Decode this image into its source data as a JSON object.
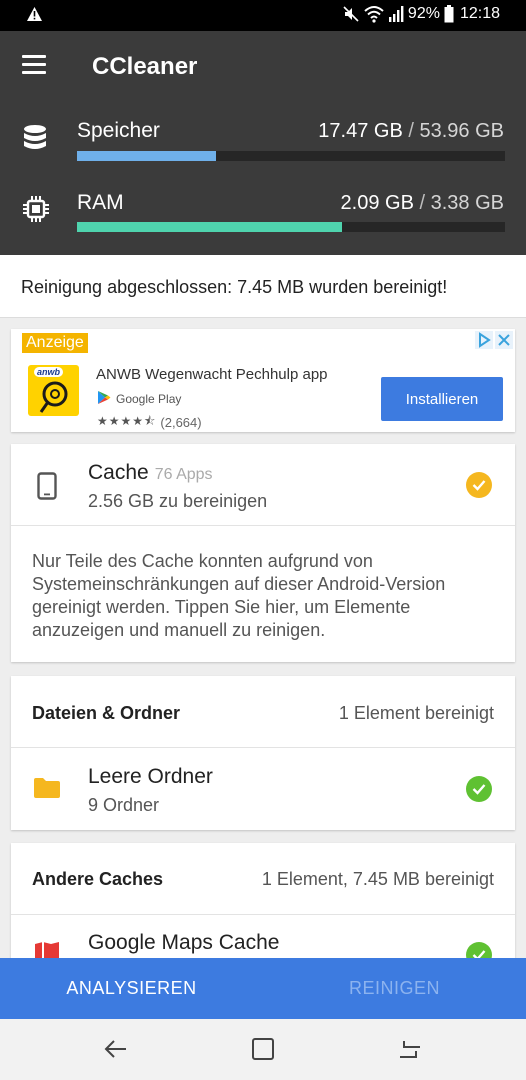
{
  "status_bar": {
    "battery": "92%",
    "time": "12:18"
  },
  "header": {
    "title": "CCleaner",
    "storage": {
      "label": "Speicher",
      "used": "17.47 GB",
      "separator": "/",
      "total": "53.96 GB",
      "fraction": 0.324,
      "color": "#6fb0ea"
    },
    "ram": {
      "label": "RAM",
      "used": "2.09 GB",
      "separator": "/",
      "total": "3.38 GB",
      "fraction": 0.618,
      "color": "#4fd4ae"
    }
  },
  "banner": {
    "text": "Reinigung abgeschlossen: 7.45 MB wurden bereinigt!"
  },
  "ad": {
    "label": "Anzeige",
    "logo_text": "anwb",
    "title": "ANWB Wegenwacht Pechhulp app",
    "store": "Google Play",
    "stars": "★★★★⯪",
    "rating_count": "(2,664)",
    "button": "Installieren"
  },
  "cache": {
    "title": "Cache",
    "apps": "76 Apps",
    "subtitle": "2.56 GB zu bereinigen",
    "note": "Nur Teile des Cache konnten aufgrund von Systemeinschränkungen auf dieser Android-Version gereinigt werden. Tippen Sie hier, um Elemente anzuzeigen und manuell zu reinigen.",
    "status_color": "#f5b71f"
  },
  "files": {
    "section": "Dateien & Ordner",
    "summary": "1 Element bereinigt",
    "item_title": "Leere Ordner",
    "item_sub": "9 Ordner",
    "status_color": "#5fc132"
  },
  "other_caches": {
    "section": "Andere Caches",
    "summary": "1 Element, 7.45 MB bereinigt",
    "item_title": "Google Maps Cache"
  },
  "bottom": {
    "analyze": "ANALYSIEREN",
    "clean": "REINIGEN"
  },
  "colors": {
    "accent": "#3d7be0",
    "header_bg": "#3b3b3b"
  }
}
